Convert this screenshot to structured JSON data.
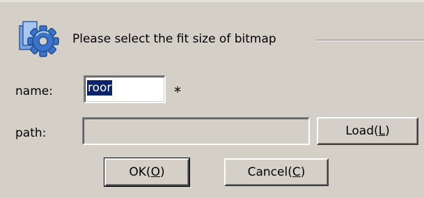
{
  "header": {
    "icon": "gear-document-icon",
    "text": "Please select the fit size of bitmap"
  },
  "fields": {
    "name_label": "name:",
    "name_value": "roor",
    "required_marker": "*",
    "path_label": "path:",
    "path_value": ""
  },
  "buttons": {
    "load": {
      "before": "Load(",
      "accel": "L",
      "after": ")"
    },
    "ok": {
      "before": "OK(",
      "accel": "O",
      "after": ")"
    },
    "cancel": {
      "before": "Cancel(",
      "accel": "C",
      "after": ")"
    }
  },
  "colors": {
    "dialog_bg": "#d4d0c8",
    "selection_bg": "#0a246a",
    "icon_blue": "#3a73c8"
  }
}
